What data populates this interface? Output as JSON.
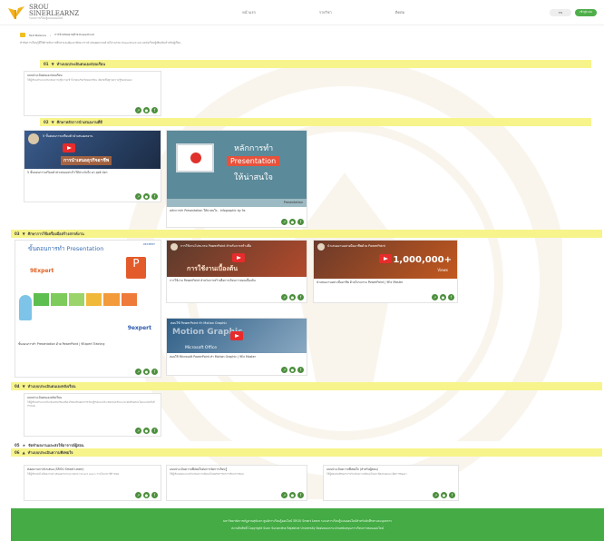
{
  "header": {
    "logo_line1": "SROU",
    "logo_line2": "SINERLEARNZ",
    "logo_line3": "ระบบการเรียนรู้แบบออนไลน์",
    "nav": [
      "หน้าแรก",
      "รายวิชา",
      "ติดต่อ"
    ],
    "btn1": "EN",
    "btn2": "เข้าสู่ระบบ"
  },
  "breadcrumb": {
    "home": "Text Balance",
    "current": "การนำเสนองานด้วย PowerPoint",
    "expanded": "หัวข้อการเรียนรู้ที่ใช้สำหรับการศึกษาและพัฒนาทักษะการนำเสนอผลงานด้วยโปรแกรม PowerPoint และแหล่งเรียนรู้เพิ่มเติมสำหรับผู้เรียน"
  },
  "sections": [
    {
      "num": "01",
      "label": "ทำแบบประเมินตนเองก่อนเรียน"
    },
    {
      "num": "02",
      "label": "ศึกษาหลักการนำเสนองานที่ดี"
    },
    {
      "num": "03",
      "label": "ศึกษาการใช้เครื่องมือสร้างสรรค์งาน"
    },
    {
      "num": "04",
      "label": "ทำแบบประเมินตนเองหลังเรียน"
    },
    {
      "num": "05",
      "label": "จัดทำผลงานและส่งให้อาจารย์ผู้สอน"
    },
    {
      "num": "06",
      "label": "ทำแบบประเมินความพึงพอใจ"
    }
  ],
  "cards": [
    {
      "title": "แบบประเมินตนเองก่อนเรียน",
      "desc": "ให้ผู้เรียนทำแบบประเมินความรู้ความเข้าใจก่อนเริ่มเรียนบทเรียน เพื่อวัดพื้นฐานความรู้ของตนเอง"
    },
    {
      "video": "5 ขั้นตอนการเตรียมตัวนำเสนอผลงาน",
      "banner": "การนำเสนอธุรกิจอาชีพ",
      "title": "5 ขั้นตอนการเตรียมตัวนำเสนออย่างไรให้ประทับใจ ดร.ยุทธ์ ฉัตร"
    },
    {
      "slide1": "หลักการทำ",
      "slide2": "Presentation",
      "slide3": "ให้น่าสนใจ",
      "footer_tag": "Presentation",
      "title": "หลักการทำ Presentation ให้น่าสนใจ - Infographic by 9x"
    },
    {
      "p1": "ขั้นตอนการทำ Presentation",
      "brand": "9EXPERT",
      "p2": "9expert",
      "title": "ขั้นตอนการทำ Presentation ด้วย PowerPoint | 9Expert Training"
    },
    {
      "video": "การใช้งานโปรแกรม PowerPoint สำหรับการสร้างสื่อ",
      "banner": "การใช้งานเบื้องต้น",
      "title": "การใช้งาน PowerPoint สำหรับการสร้างสื่อการเรียนการสอนเบื้องต้น"
    },
    {
      "video": "นำเสนองานอย่างมืออาชีพด้วย PowerPoint",
      "views": "1,000,000+",
      "views_label": "Views",
      "title": "นำเสนองานอย่างมืออาชีพ ด้วยโปรแกรม PowerPoint | 9Ex Master"
    },
    {
      "video": "สอนใช้ PowerPoint ทำ Motion Graphic",
      "banner": "Microsoft Office",
      "overlay": "Motion Graphic",
      "title": "สอนใช้ Microsoft PowerPoint ทำ Motion Graphic | 9Ex Master"
    },
    {
      "title": "แบบประเมินตนเองหลังเรียน",
      "desc": "ให้ผู้เรียนทำแบบประเมินหลังเรียนเพื่อเปรียบเทียบผลการเรียนรู้กับแบบประเมินก่อนเรียน และบันทึกผลลงในแบบฟอร์มที่กำหนด"
    },
    {
      "title": "ส่งผลงานการนำเสนอ (SROU Smart Learn)",
      "desc": "ให้ผู้เรียนส่งไฟล์ผลงานนำเสนอผ่านระบบ SROU Smart Learn ภายในเวลาที่กำหนด"
    },
    {
      "title": "แบบประเมินความพึงพอใจต่อการจัดการเรียนรู้",
      "desc": "ให้ผู้เรียนตอบแบบประเมินความพึงพอใจต่อกิจกรรมการเรียนการสอน"
    },
    {
      "title": "แบบประเมินความพึงพอใจ (สำหรับผู้สอน)",
      "desc": "ให้ผู้สอนบันทึกผลการประเมินความพึงพอใจและข้อเสนอแนะเพื่อการพัฒนา"
    }
  ],
  "footer": {
    "line1": "มหาวิทยาลัยราชภัฏสวนสุนันทา ศูนย์การเรียนรู้ออนไลน์ SROU Smart Learn ระบบการเรียนรู้แบบออนไลน์สำหรับนักศึกษาและบุคลากร",
    "line2": "สงวนลิขสิทธิ์ Copyright Suan Sunandha Rajabhat University ติดต่อสอบถาม ฝ่ายสนับสนุนการเรียนการสอนออนไลน์"
  },
  "colors": {
    "accent": "#45ab45",
    "section_bar": "#f7f48b",
    "icon": "#4b8e3c"
  }
}
